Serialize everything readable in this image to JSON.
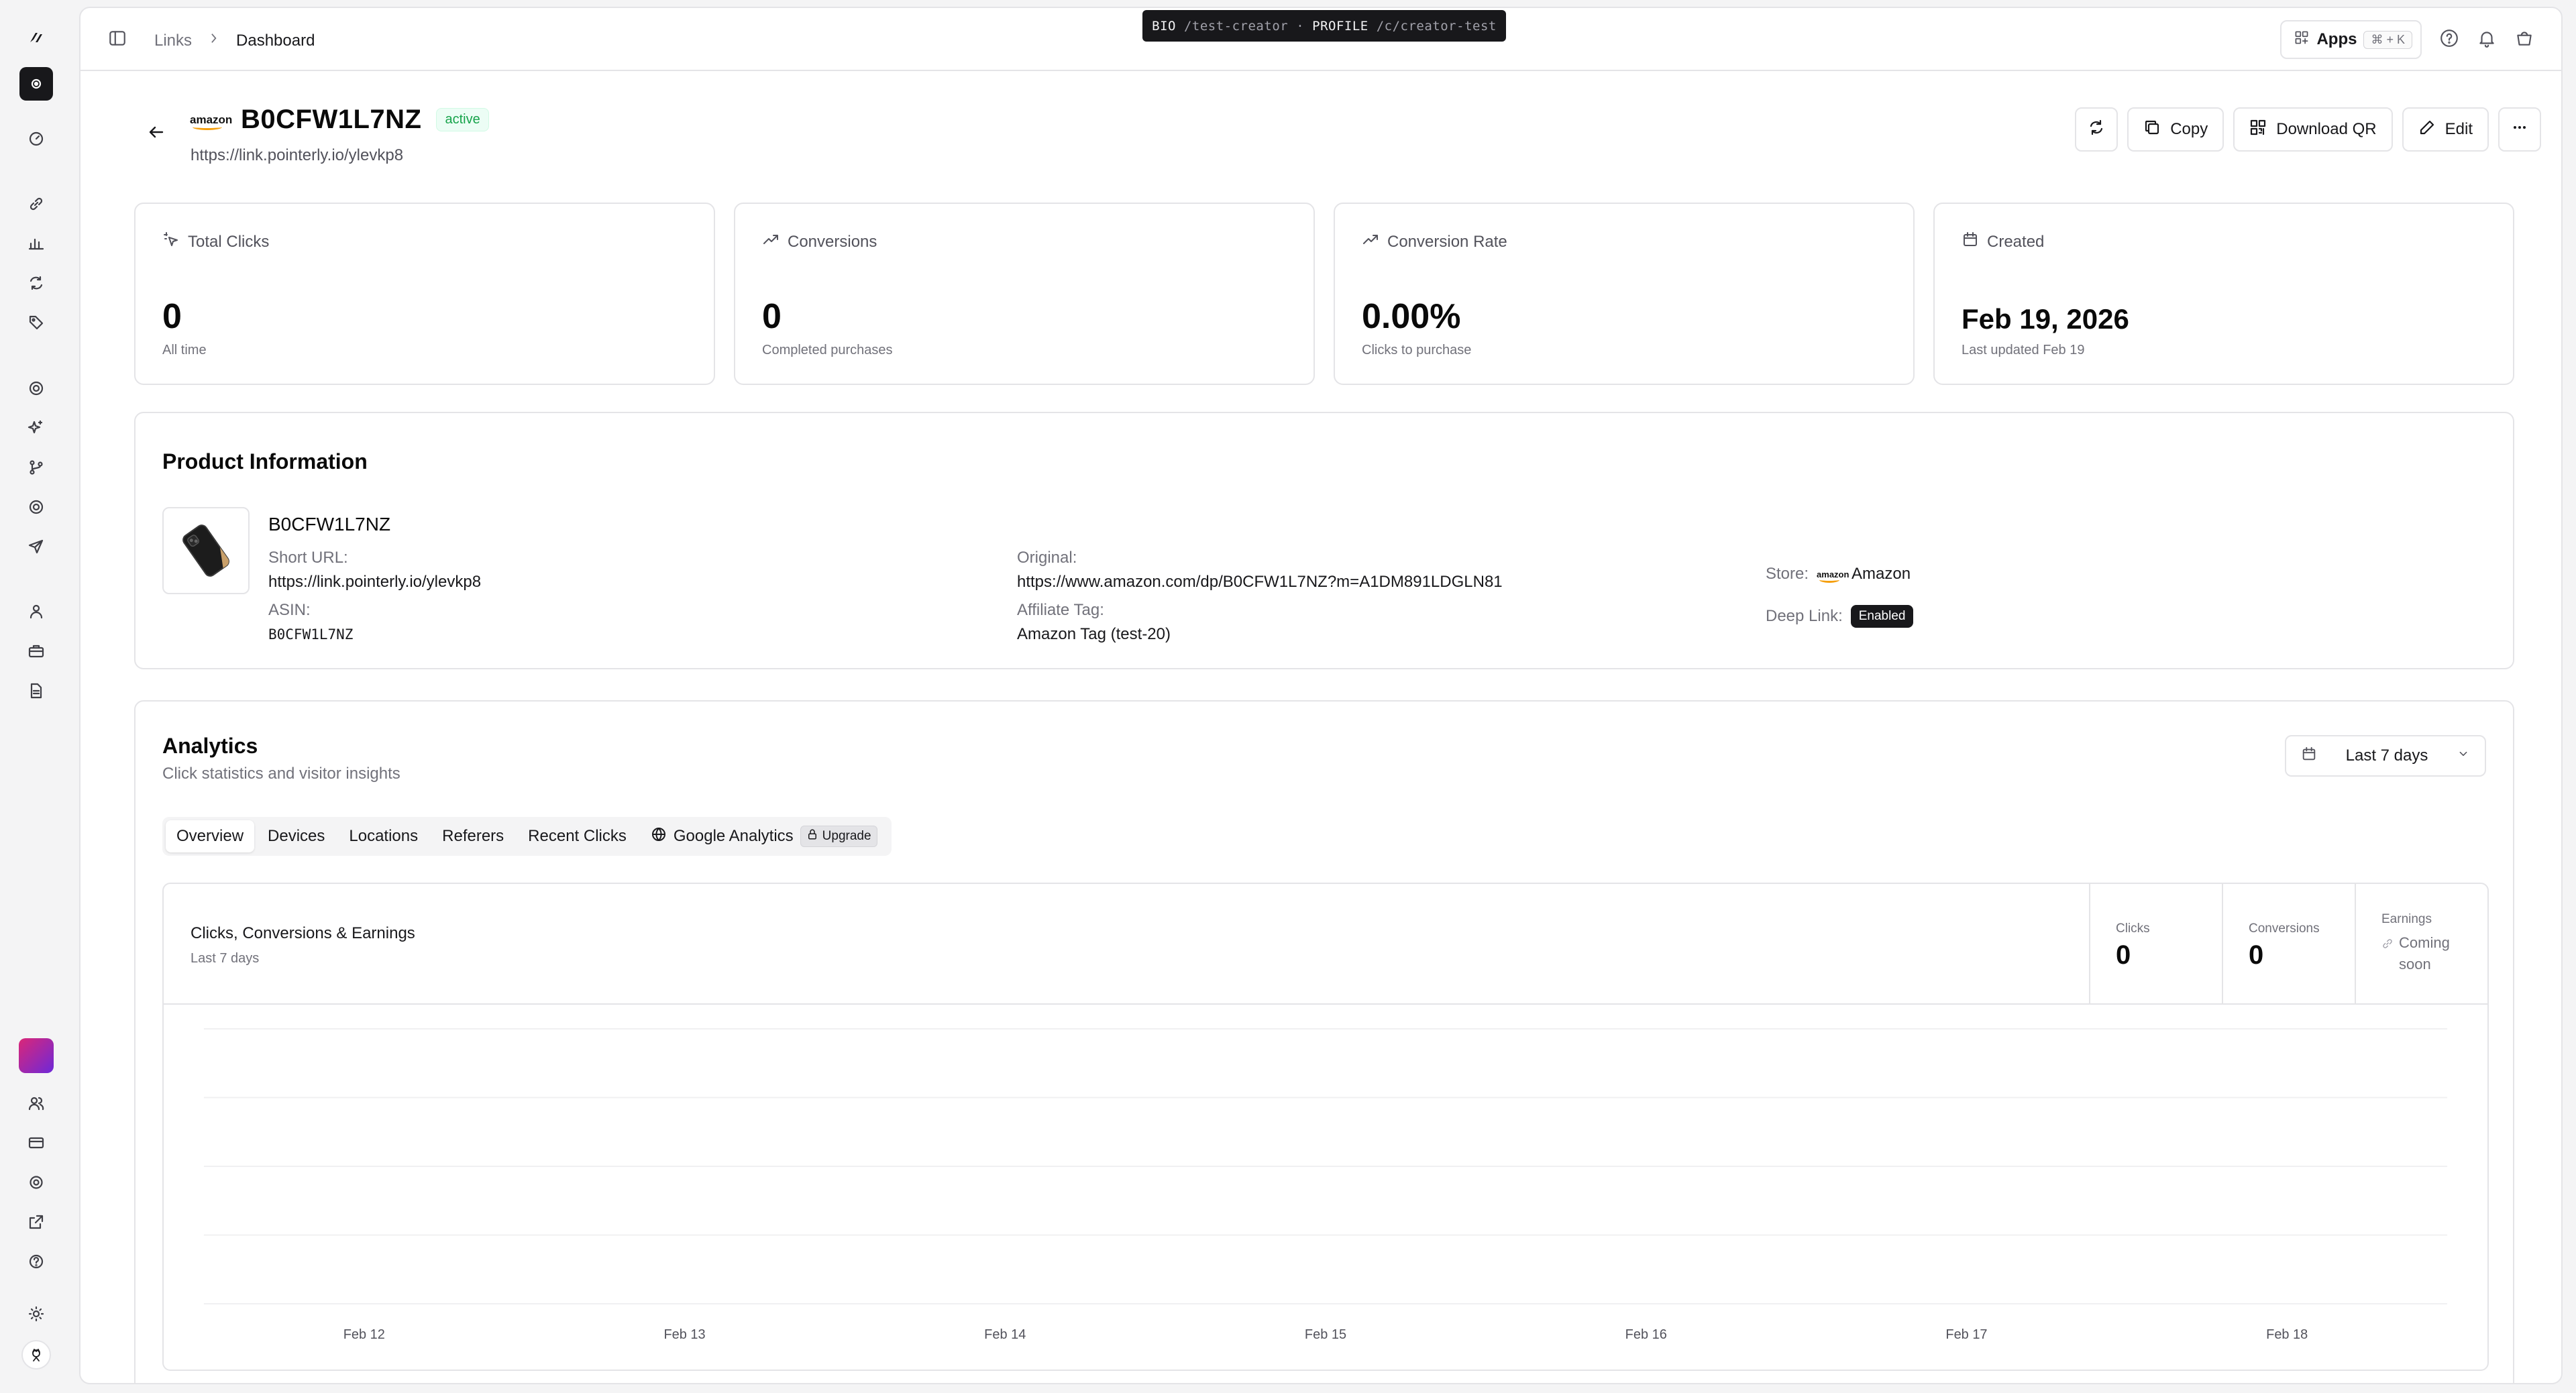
{
  "topbar": {
    "breadcrumb": [
      "Links",
      "Dashboard"
    ],
    "env_bio_label": "BIO",
    "env_bio_path": "/test-creator",
    "env_sep": "·",
    "env_profile_label": "PROFILE",
    "env_profile_path": "/c/creator-test",
    "apps_label": "Apps",
    "apps_shortcut": "⌘ + K"
  },
  "link": {
    "store_logo_text": "amazon",
    "title": "B0CFW1L7NZ",
    "status": "active",
    "short_url": "https://link.pointerly.io/ylevkp8",
    "actions": {
      "copy": "Copy",
      "download_qr": "Download QR",
      "edit": "Edit"
    }
  },
  "stats": [
    {
      "label": "Total Clicks",
      "value": "0",
      "sub": "All time",
      "icon": "sparkle-click-icon"
    },
    {
      "label": "Conversions",
      "value": "0",
      "sub": "Completed purchases",
      "icon": "trending-up-icon"
    },
    {
      "label": "Conversion Rate",
      "value": "0.00%",
      "sub": "Clicks to purchase",
      "icon": "trending-up-icon"
    },
    {
      "label": "Created",
      "value": "Feb 19, 2026",
      "sub": "Last updated Feb 19",
      "icon": "calendar-icon"
    }
  ],
  "product": {
    "section_title": "Product Information",
    "name": "B0CFW1L7NZ",
    "short_url_label": "Short URL:",
    "short_url": "https://link.pointerly.io/ylevkp8",
    "asin_label": "ASIN:",
    "asin": "B0CFW1L7NZ",
    "original_label": "Original:",
    "original": "https://www.amazon.com/dp/B0CFW1L7NZ?m=A1DM891LDGLN81",
    "affiliate_label": "Affiliate Tag:",
    "affiliate": "Amazon Tag (test-20)",
    "store_label": "Store:",
    "store": "Amazon",
    "deeplink_label": "Deep Link:",
    "deeplink": "Enabled"
  },
  "analytics": {
    "title": "Analytics",
    "subtitle": "Click statistics and visitor insights",
    "range": "Last 7 days",
    "tabs": [
      "Overview",
      "Devices",
      "Locations",
      "Referers",
      "Recent Clicks",
      "Google Analytics"
    ],
    "upgrade_label": "Upgrade",
    "chart_title": "Clicks, Conversions & Earnings",
    "chart_sub": "Last 7 days",
    "metrics": {
      "clicks_label": "Clicks",
      "clicks": "0",
      "conversions_label": "Conversions",
      "conversions": "0",
      "earnings_label": "Earnings",
      "earnings": "Coming soon"
    }
  },
  "chart_data": {
    "type": "line",
    "categories": [
      "Feb 12",
      "Feb 13",
      "Feb 14",
      "Feb 15",
      "Feb 16",
      "Feb 17",
      "Feb 18"
    ],
    "series": [
      {
        "name": "Clicks",
        "values": [
          0,
          0,
          0,
          0,
          0,
          0,
          0
        ]
      },
      {
        "name": "Conversions",
        "values": [
          0,
          0,
          0,
          0,
          0,
          0,
          0
        ]
      }
    ],
    "grid": true,
    "colors": {
      "grid": "#f0f0f2",
      "tick": "#52525b"
    }
  }
}
